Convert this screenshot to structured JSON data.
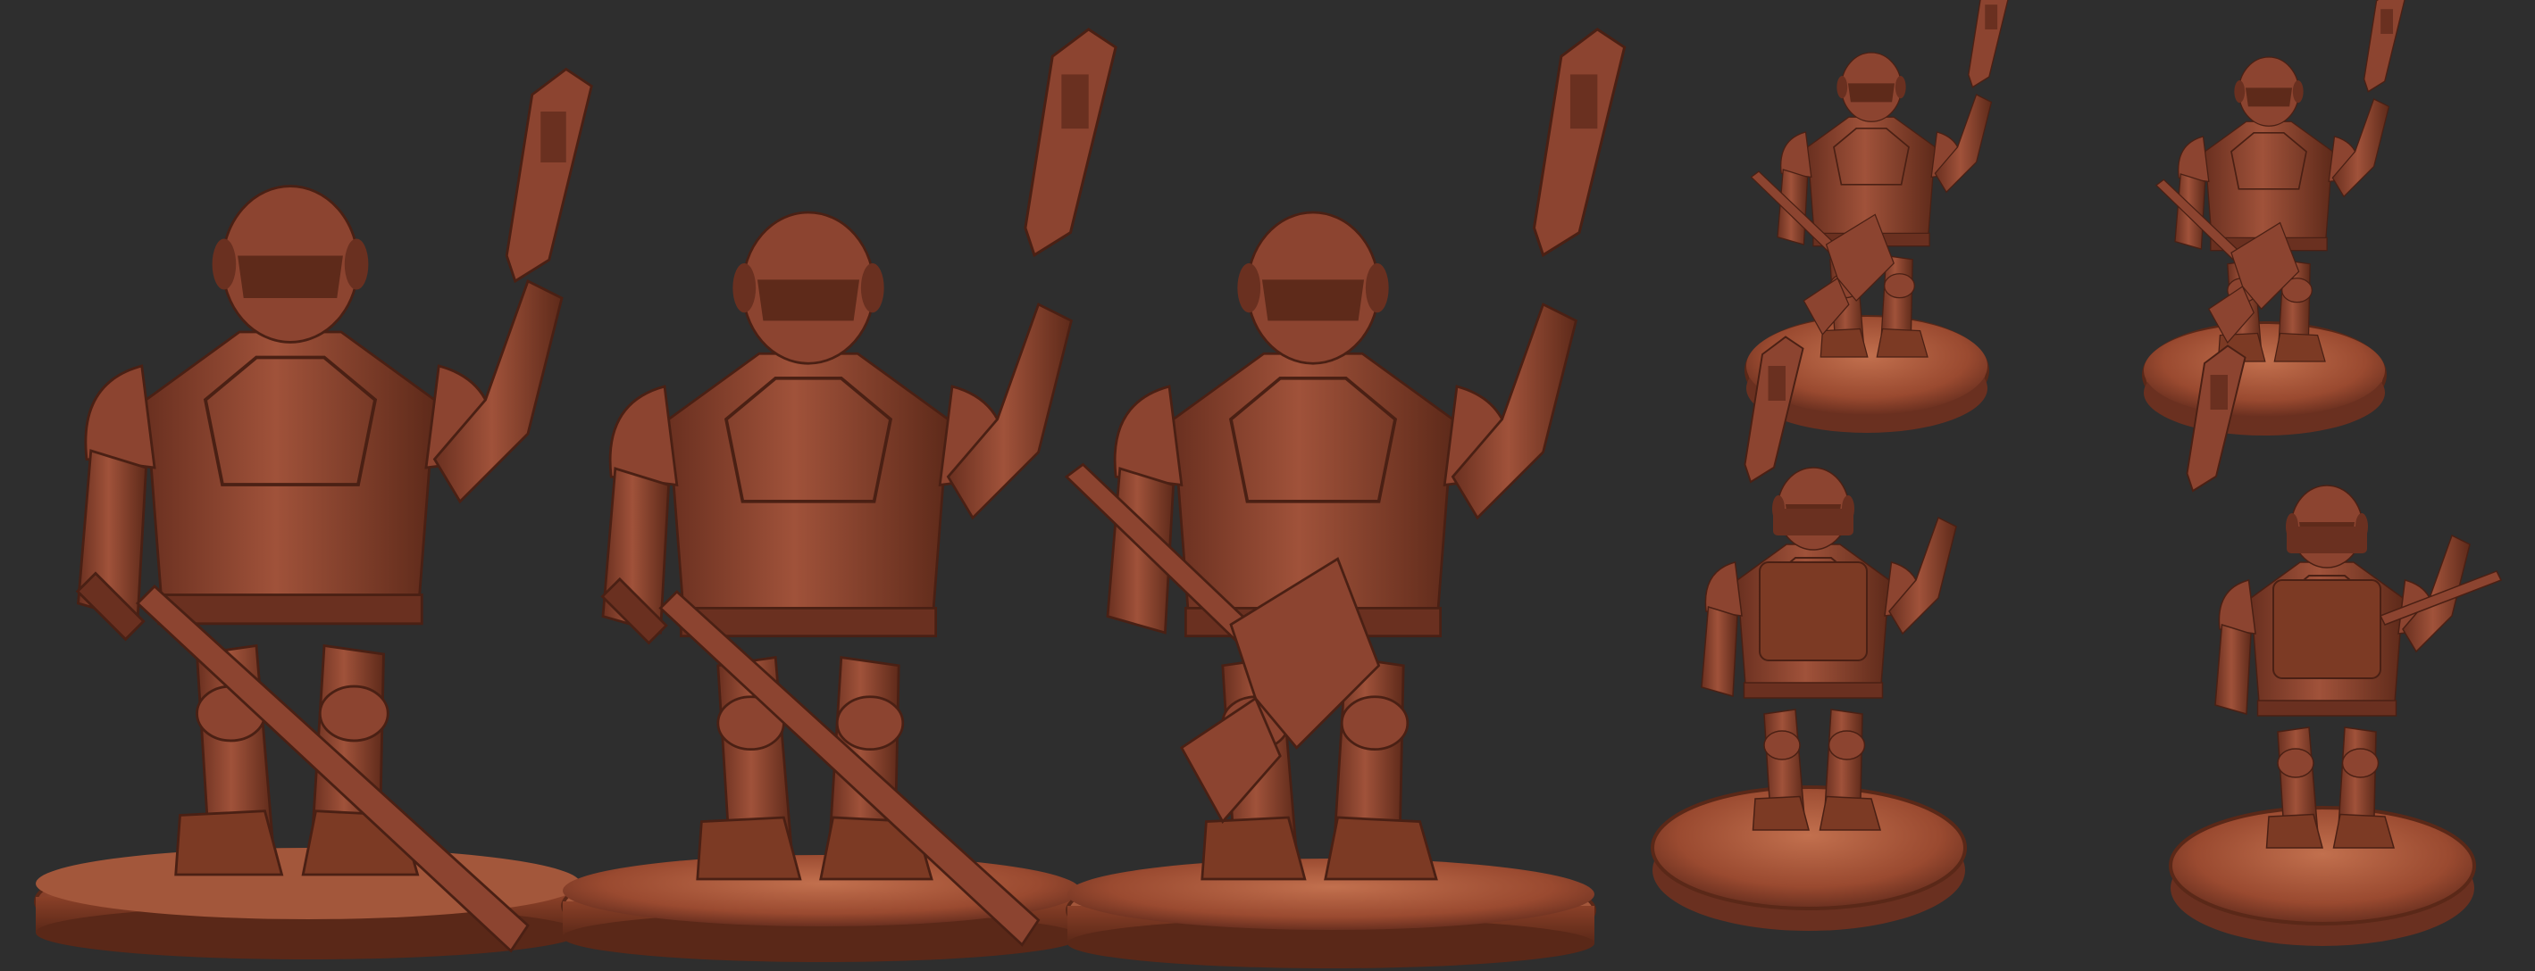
{
  "image": {
    "subject": "",
    "background_color": "#2e2e2e",
    "clay_color": "#9a4a30",
    "clay_dark": "#5e2a1a",
    "clay_light": "#c06a4a"
  },
  "views": [
    {
      "id": "front-sword-large",
      "weapon": "sword",
      "view": "front"
    },
    {
      "id": "front-sword-masked",
      "weapon": "sword",
      "view": "front"
    },
    {
      "id": "front-axe-mustache",
      "weapon": "axe",
      "view": "front"
    },
    {
      "id": "three-quarter-axe",
      "weapon": "axe",
      "view": "top"
    },
    {
      "id": "three-quarter-axe-2",
      "weapon": "axe",
      "view": "top"
    },
    {
      "id": "back-view-1",
      "weapon": "axe",
      "view": "back"
    },
    {
      "id": "back-view-2",
      "weapon": "axe",
      "view": "back"
    }
  ]
}
